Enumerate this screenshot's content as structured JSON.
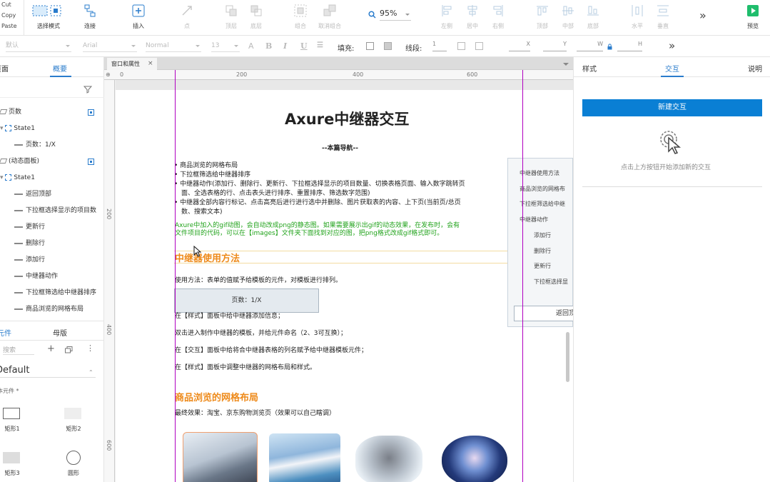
{
  "toolbar": {
    "edit_items": [
      "Cut",
      "Copy",
      "Paste"
    ],
    "select_mode": "选择模式",
    "connect": "连接",
    "insert": "插入",
    "point": "点",
    "top_layer": "顶层",
    "bottom_layer": "底层",
    "group": "组合",
    "ungroup": "取消组合",
    "zoom": "95%",
    "align_left": "左侧",
    "align_center": "居中",
    "align_right": "右侧",
    "align_top": "顶部",
    "align_middle": "中部",
    "align_bottom": "底部",
    "dist_h": "水平",
    "dist_v": "垂直",
    "more": "»",
    "preview": "预览"
  },
  "format_bar": {
    "style": "默认",
    "font": "Arial",
    "weight": "Normal",
    "size": "13",
    "fill_label": "填充:",
    "stroke_label": "线段:",
    "stroke_value": "1",
    "x_label": "X",
    "y_label": "Y",
    "w_label": "W",
    "h_label": "H",
    "more": "»"
  },
  "left_panel": {
    "tabs": [
      "页面",
      "概要"
    ],
    "outline": [
      {
        "label": "页数",
        "level": 0,
        "type": "layer",
        "visible": true
      },
      {
        "label": "State1",
        "level": 1,
        "type": "state"
      },
      {
        "label": "页数：1/X",
        "level": 2,
        "type": "item"
      },
      {
        "label": "(动态面板)",
        "level": 0,
        "type": "layer",
        "visible": true
      },
      {
        "label": "State1",
        "level": 1,
        "type": "state"
      },
      {
        "label": "返回顶部",
        "level": 2,
        "type": "item"
      },
      {
        "label": "下拉框选择显示的项目数",
        "level": 2,
        "type": "item"
      },
      {
        "label": "更新行",
        "level": 2,
        "type": "item"
      },
      {
        "label": "删除行",
        "level": 2,
        "type": "item"
      },
      {
        "label": "添加行",
        "level": 2,
        "type": "item"
      },
      {
        "label": "中继器动作",
        "level": 2,
        "type": "item"
      },
      {
        "label": "下拉框筛选给中继器排序",
        "level": 2,
        "type": "item"
      },
      {
        "label": "商品浏览的网格布局",
        "level": 2,
        "type": "item"
      }
    ],
    "lib_tabs": [
      "元件",
      "母版"
    ],
    "search_placeholder": "搜索",
    "library": "Default",
    "category": "基本元件 *",
    "widgets": [
      "矩形1",
      "矩形2",
      "矩形3",
      "圆形"
    ]
  },
  "canvas": {
    "doc_tab": "窗口和属性",
    "ruler_h": [
      "0",
      "200",
      "400",
      "600"
    ],
    "ruler_v": [
      "200",
      "400",
      "600"
    ],
    "title": "Axure中继器交互",
    "nav_title": "--本篇导航--",
    "bullets": [
      "商品浏览的网格布局",
      "下拉框筛选给中继器排序",
      "中继器动作(添加行、删除行、更新行、下拉框选择显示的项目数量、切换表格页面、输入数字跳转页",
      "面、全选表格的行、点击表头进行排序、重置排序、筛选数字范围)",
      "中继器全部内容行标记、点击高亮后进行进行选中并删除、图片获取表的内容、上下页(当前页/总页",
      "数、搜索文本)"
    ],
    "green_note_1": "Axure中加入的gif动图，会自动改成png的静态图。如果需要展示出gif的动态效果，在发布时，会有",
    "green_note_2": "文件项目的代码，可以在【images】文件夹下面找到对应的图，把png格式改成gif格式即可。",
    "section_usage": "中继器使用方法",
    "usage_text": "使用方法：表单的值赋予给模板的元件，对模板进行排列。",
    "page_box": "页数：1/X",
    "step1": "在【样式】面板中给中继器添加信息；",
    "step2": "双击进入制作中继器的模板，并给元件命名（2、3可互换）；",
    "step3": "在【交互】面板中给将合中继器表格的列名赋予给中继器模板元件；",
    "step4": "在【样式】面板中调整中继器的网格布局和样式。",
    "section_grid": "商品浏览的网格布局",
    "final_effect": "最终效果：淘宝、京东购物浏览页（效果可以自己瞎调）",
    "side_menu": [
      "中继器使用方法",
      "商品浏览的网格布",
      "下拉框筛选给中继",
      "中继器动作",
      "添加行",
      "删除行",
      "更新行",
      "下拉框选择显"
    ],
    "side_back": "返回顶"
  },
  "right_panel": {
    "tabs": [
      "样式",
      "交互",
      "说明"
    ],
    "new_interaction": "新建交互",
    "hint": "点击上方按钮开始添加新的交互"
  },
  "colors": {
    "accent": "#0a7fd4",
    "guide": "#b000c0",
    "green_text": "#22a31c",
    "orange_heading": "#ee8a1a",
    "preview_green": "#1fbd6c"
  }
}
